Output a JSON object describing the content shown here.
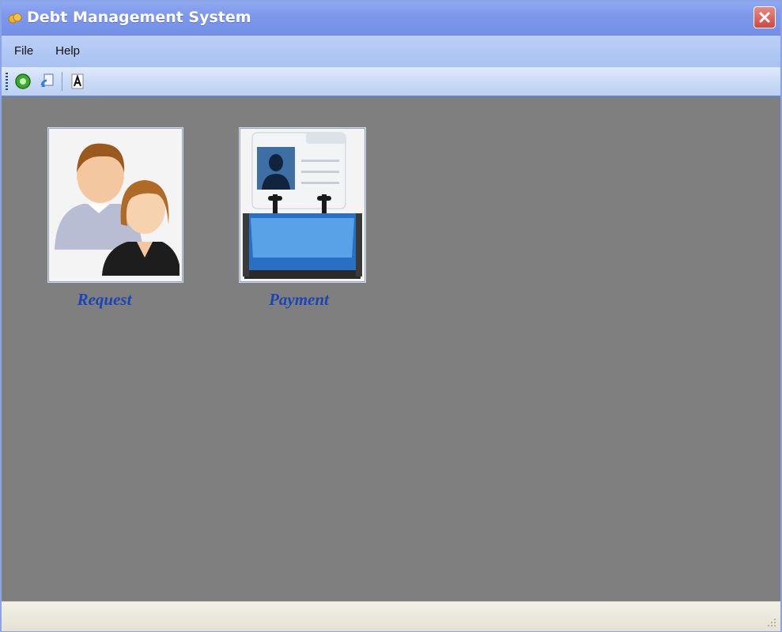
{
  "window": {
    "title": "Debt Management System",
    "app_icon": "coins-icon",
    "close_icon": "close-icon"
  },
  "menu": {
    "items": [
      {
        "label": "File"
      },
      {
        "label": "Help"
      }
    ]
  },
  "toolbar": {
    "buttons": [
      {
        "icon": "green-circle-icon"
      },
      {
        "icon": "refresh-document-icon"
      },
      {
        "icon": "font-a-icon"
      }
    ]
  },
  "tiles": [
    {
      "label": "Request",
      "icon": "users-people-icon"
    },
    {
      "label": "Payment",
      "icon": "rolodex-card-icon"
    }
  ],
  "colors": {
    "title_bar": "#7d97ea",
    "menu_bar": "#b2c8f4",
    "workspace": "#7f7f7f",
    "tile_label": "#1a46b5",
    "status_bar": "#ece9dc"
  }
}
